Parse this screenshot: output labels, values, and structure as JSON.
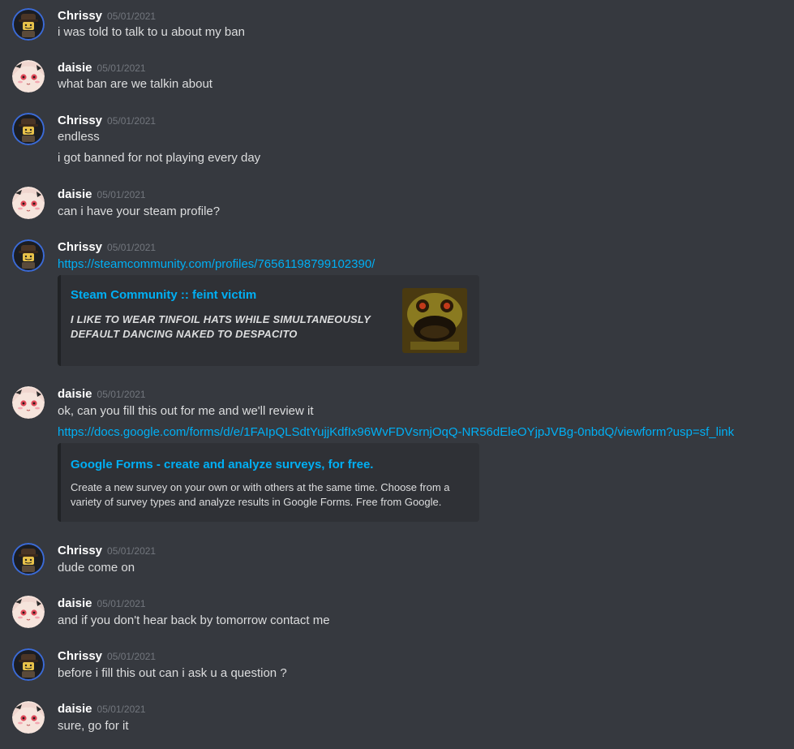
{
  "users": {
    "chrissy": "Chrissy",
    "daisie": "daisie"
  },
  "icons": {
    "chrissy_avatar": "lego-minifig-avatar-icon",
    "daisie_avatar": "anime-girl-avatar-icon",
    "steam_thumb": "monster-face-thumbnail-icon"
  },
  "colors": {
    "background": "#36393f",
    "link": "#00aff4",
    "embed_bg": "#2f3136",
    "timestamp": "#72767d",
    "avatar_ring": "#3b6bd8"
  },
  "messages": [
    {
      "author": "Chrissy",
      "timestamp": "05/01/2021",
      "lines": [
        "i was told to talk to u about my ban"
      ]
    },
    {
      "author": "daisie",
      "timestamp": "05/01/2021",
      "lines": [
        "what ban are we talkin about"
      ]
    },
    {
      "author": "Chrissy",
      "timestamp": "05/01/2021",
      "lines": [
        "endless",
        "i got banned for not playing every day"
      ]
    },
    {
      "author": "daisie",
      "timestamp": "05/01/2021",
      "lines": [
        "can i have your steam profile?"
      ]
    },
    {
      "author": "Chrissy",
      "timestamp": "05/01/2021",
      "link": "https://steamcommunity.com/profiles/76561198799102390/",
      "embed": {
        "title": "Steam Community :: feint victim",
        "description": "I LIKE TO WEAR TINFOIL HATS WHILE SIMULTANEOUSLY DEFAULT DANCING NAKED TO DESPACITO"
      }
    },
    {
      "author": "daisie",
      "timestamp": "05/01/2021",
      "lines": [
        "ok, can you fill this out for me and we'll review it"
      ],
      "link": "https://docs.google.com/forms/d/e/1FAIpQLSdtYujjKdfIx96WvFDVsrnjOqQ-NR56dEleOYjpJVBg-0nbdQ/viewform?usp=sf_link",
      "embed": {
        "title": "Google Forms - create and analyze surveys, for free.",
        "description": "Create a new survey on your own or with others at the same time. Choose from a variety of survey types and analyze results in Google Forms. Free from Google."
      }
    },
    {
      "author": "Chrissy",
      "timestamp": "05/01/2021",
      "lines": [
        "dude come on"
      ]
    },
    {
      "author": "daisie",
      "timestamp": "05/01/2021",
      "lines": [
        "and if you don't hear back by tomorrow contact me"
      ]
    },
    {
      "author": "Chrissy",
      "timestamp": "05/01/2021",
      "lines": [
        "before i fill this out can i ask u a question ?"
      ]
    },
    {
      "author": "daisie",
      "timestamp": "05/01/2021",
      "lines": [
        "sure, go for it"
      ]
    }
  ]
}
